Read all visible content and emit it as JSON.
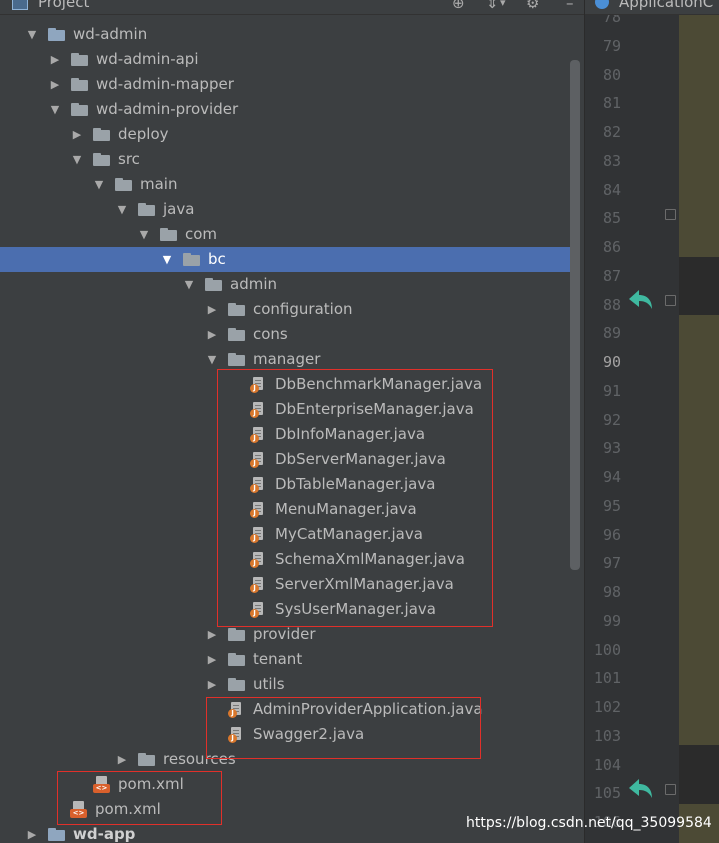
{
  "project_panel": {
    "title": "Project",
    "tree": [
      {
        "label": "wd-admin",
        "icon": "folder-icon"
      },
      {
        "label": "wd-admin-api",
        "icon": "folder-icon"
      },
      {
        "label": "wd-admin-mapper",
        "icon": "folder-icon"
      },
      {
        "label": "wd-admin-provider",
        "icon": "folder-icon"
      },
      {
        "label": "deploy",
        "icon": "folder-icon"
      },
      {
        "label": "src",
        "icon": "folder-icon"
      },
      {
        "label": "main",
        "icon": "folder-icon"
      },
      {
        "label": "java",
        "icon": "folder-icon"
      },
      {
        "label": "com",
        "icon": "folder-icon"
      },
      {
        "label": "bc",
        "icon": "folder-icon",
        "selected": true
      },
      {
        "label": "admin",
        "icon": "folder-icon"
      },
      {
        "label": "configuration",
        "icon": "folder-icon"
      },
      {
        "label": "cons",
        "icon": "folder-icon"
      },
      {
        "label": "manager",
        "icon": "folder-icon"
      },
      {
        "label": "DbBenchmarkManager.java",
        "icon": "java-file-icon"
      },
      {
        "label": "DbEnterpriseManager.java",
        "icon": "java-file-icon"
      },
      {
        "label": "DbInfoManager.java",
        "icon": "java-file-icon"
      },
      {
        "label": "DbServerManager.java",
        "icon": "java-file-icon"
      },
      {
        "label": "DbTableManager.java",
        "icon": "java-file-icon"
      },
      {
        "label": "MenuManager.java",
        "icon": "java-file-icon"
      },
      {
        "label": "MyCatManager.java",
        "icon": "java-file-icon"
      },
      {
        "label": "SchemaXmlManager.java",
        "icon": "java-file-icon"
      },
      {
        "label": "ServerXmlManager.java",
        "icon": "java-file-icon"
      },
      {
        "label": "SysUserManager.java",
        "icon": "java-file-icon"
      },
      {
        "label": "provider",
        "icon": "folder-icon"
      },
      {
        "label": "tenant",
        "icon": "folder-icon"
      },
      {
        "label": "utils",
        "icon": "folder-icon"
      },
      {
        "label": "AdminProviderApplication.java",
        "icon": "java-file-icon"
      },
      {
        "label": "Swagger2.java",
        "icon": "java-file-icon"
      },
      {
        "label": "resources",
        "icon": "folder-icon"
      },
      {
        "label": "pom.xml",
        "icon": "maven-file-icon"
      },
      {
        "label": "pom.xml",
        "icon": "maven-file-icon"
      },
      {
        "label": "wd-app",
        "icon": "folder-icon"
      }
    ]
  },
  "editor": {
    "tab_label": "ApplicationC",
    "line_numbers": [
      "78",
      "79",
      "80",
      "81",
      "82",
      "83",
      "84",
      "85",
      "86",
      "87",
      "88",
      "89",
      "90",
      "91",
      "92",
      "93",
      "94",
      "95",
      "96",
      "97",
      "98",
      "99",
      "100",
      "101",
      "102",
      "103",
      "104",
      "105",
      "106"
    ],
    "current_line": "90"
  },
  "colors": {
    "panel_bg": "#3c3f41",
    "selection": "#4b6eaf",
    "gutter_bg": "#313335",
    "editor_bg": "#2b2b2b",
    "highlight_box": "#e0302a",
    "code_highlight": "#4c4a35",
    "gutter_arrow": "#3fb9a0"
  },
  "watermark": "https://blog.csdn.net/qq_35099584"
}
